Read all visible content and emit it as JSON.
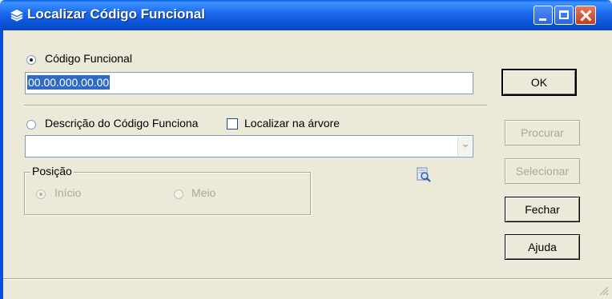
{
  "window": {
    "title": "Localizar Código Funcional",
    "colors": {
      "titlebar": "#0a53d8",
      "face": "#ece9d8",
      "selection": "#316ac5"
    }
  },
  "codigo": {
    "radio_label": "Código Funcional",
    "checked": true,
    "value": "00.00.000.00.00"
  },
  "descricao": {
    "radio_label": "Descrição do Código Funciona",
    "checked": false,
    "checkbox_label": "Localizar na árvore",
    "combo_value": ""
  },
  "posicao": {
    "group_title": "Posição",
    "options": [
      {
        "label": "Início",
        "checked": true,
        "enabled": false
      },
      {
        "label": "Meio",
        "checked": false,
        "enabled": false
      }
    ]
  },
  "buttons": {
    "ok": "OK",
    "procurar": "Procurar",
    "selecionar": "Selecionar",
    "fechar": "Fechar",
    "ajuda": "Ajuda"
  }
}
